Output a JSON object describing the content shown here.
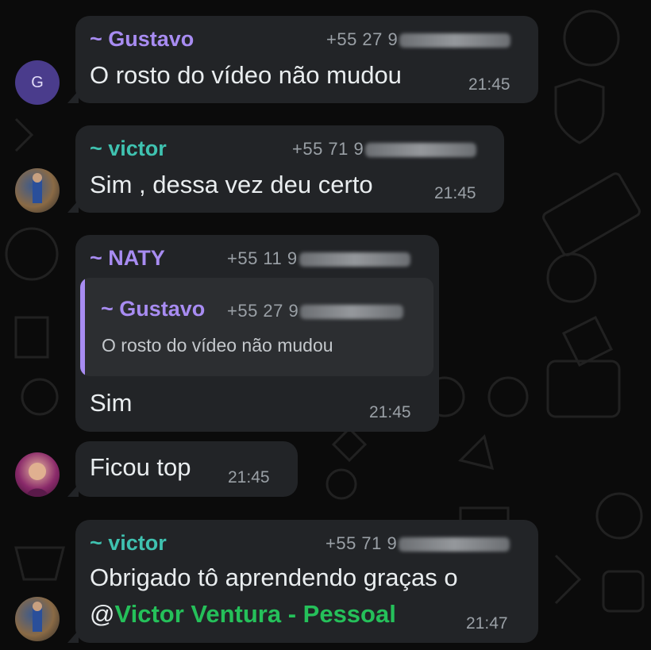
{
  "colors": {
    "gustavo": "#a88cf2",
    "victor": "#3fc2b0",
    "naty": "#a88cf2",
    "mention": "#25c05a",
    "bubble": "#222427",
    "background": "#0b0b0b"
  },
  "messages": [
    {
      "avatar_letter": "G",
      "sender": "~ Gustavo",
      "phone": "+55 27 9",
      "text": "O rosto do vídeo não mudou",
      "time": "21:45"
    },
    {
      "avatar_icon": "victor-photo",
      "sender": "~ victor",
      "phone": "+55 71 9",
      "text": "Sim , dessa vez deu certo",
      "time": "21:45"
    },
    {
      "sender": "~ NATY",
      "phone": "+55 11 9",
      "quote": {
        "sender": "~ Gustavo",
        "phone": "+55 27 9",
        "text": "O rosto do vídeo não mudou"
      },
      "text": "Sim",
      "time": "21:45"
    },
    {
      "avatar_icon": "naty-photo",
      "text": "Ficou top",
      "time": "21:45"
    },
    {
      "avatar_icon": "victor-photo",
      "sender": "~ victor",
      "phone": "+55 71 9",
      "text": "Obrigado tô aprendendo graças o",
      "mention_prefix": "@",
      "mention": "Victor Ventura - Pessoal",
      "time": "21:47"
    }
  ]
}
